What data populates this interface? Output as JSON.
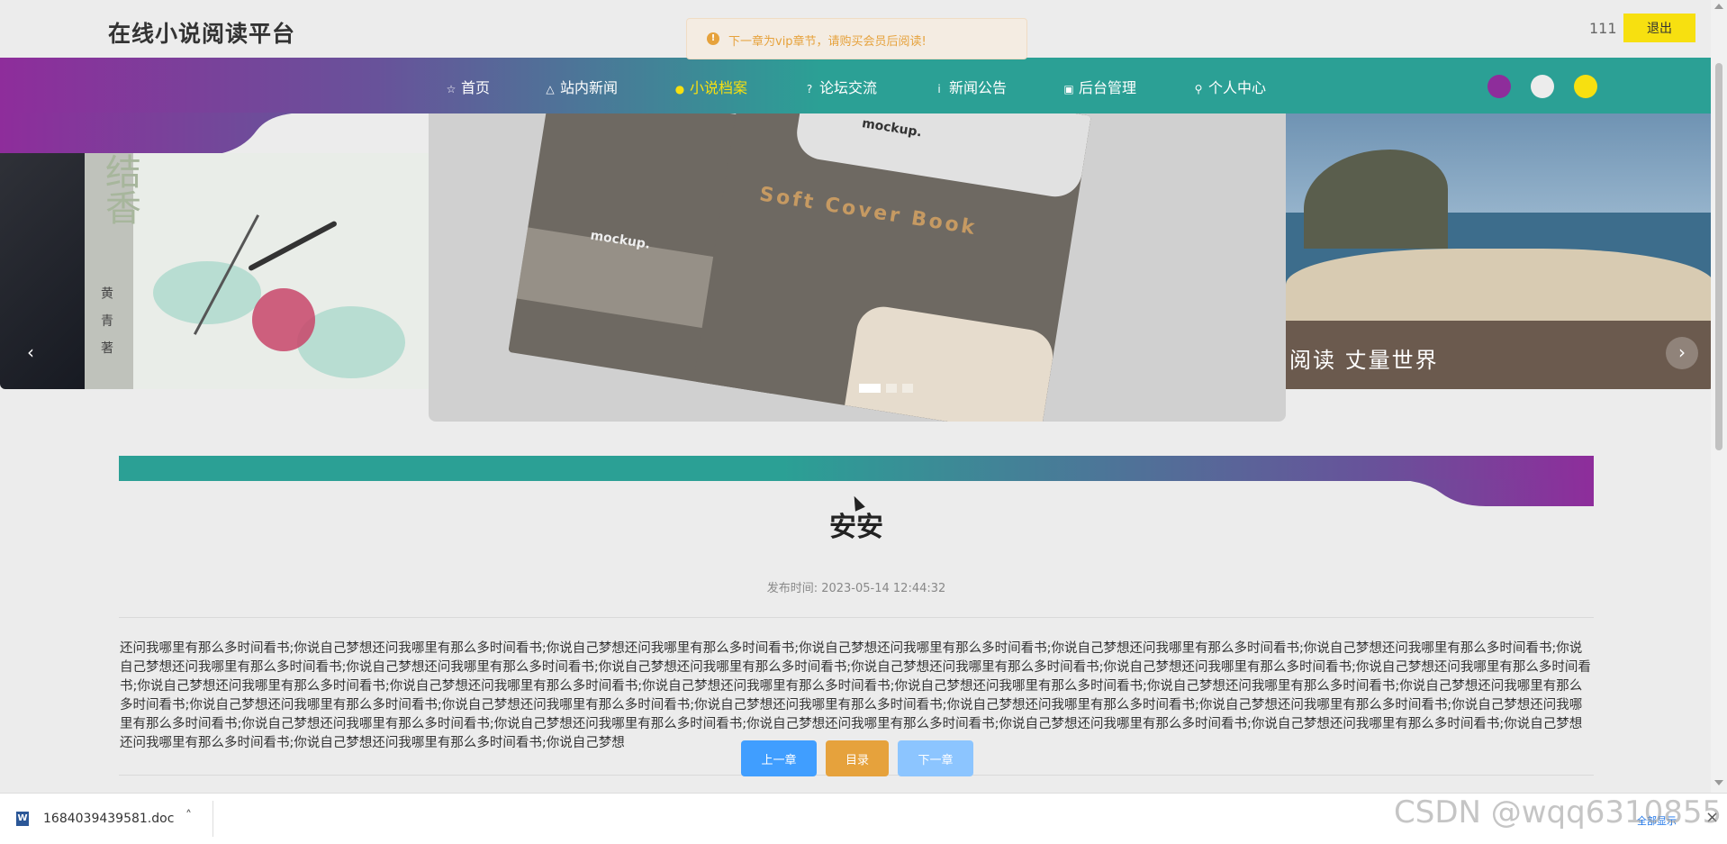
{
  "site": {
    "title": "在线小说阅读平台",
    "username": "111",
    "logout_label": "退出"
  },
  "nav": {
    "items": [
      {
        "label": "首页",
        "icon": "star-icon",
        "glyph": "☆",
        "active": false
      },
      {
        "label": "站内新闻",
        "icon": "bag-icon",
        "glyph": "△",
        "active": false
      },
      {
        "label": "小说档案",
        "icon": "info-circle-icon",
        "glyph": "●",
        "active": true
      },
      {
        "label": "论坛交流",
        "icon": "question-circle-icon",
        "glyph": "?",
        "active": false
      },
      {
        "label": "新闻公告",
        "icon": "info-icon",
        "glyph": "i",
        "active": false
      },
      {
        "label": "后台管理",
        "icon": "briefcase-icon",
        "glyph": "▣",
        "active": false
      },
      {
        "label": "个人中心",
        "icon": "user-icon",
        "glyph": "⚲",
        "active": false
      }
    ],
    "theme_colors": [
      "#8e2d9b",
      "#ececec",
      "#f7e010"
    ],
    "active_color": "#f7e010"
  },
  "toast": {
    "message": "下一章为vip章节，请购买会员后阅读!",
    "icon": "warning-icon"
  },
  "carousel": {
    "left": {
      "title": "结香",
      "author": "黄 青 著"
    },
    "center": {
      "logo": "mockup.",
      "cover_text": "Soft Cover Book",
      "back_logo": "mockup."
    },
    "right": {
      "caption": "阅读 丈量世界"
    },
    "slide_count": 3,
    "active_index": 0,
    "prev_icon": "chevron-left-icon",
    "next_icon": "chevron-right-icon"
  },
  "chapter": {
    "title": "安安",
    "publish_label": "发布时间:",
    "publish_time": "2023-05-14 12:44:32",
    "content": "还问我哪里有那么多时间看书;你说自己梦想还问我哪里有那么多时间看书;你说自己梦想还问我哪里有那么多时间看书;你说自己梦想还问我哪里有那么多时间看书;你说自己梦想还问我哪里有那么多时间看书;你说自己梦想还问我哪里有那么多时间看书;你说自己梦想还问我哪里有那么多时间看书;你说自己梦想还问我哪里有那么多时间看书;你说自己梦想还问我哪里有那么多时间看书;你说自己梦想还问我哪里有那么多时间看书;你说自己梦想还问我哪里有那么多时间看书;你说自己梦想还问我哪里有那么多时间看书;你说自己梦想还问我哪里有那么多时间看书;你说自己梦想还问我哪里有那么多时间看书;你说自己梦想还问我哪里有那么多时间看书;你说自己梦想还问我哪里有那么多时间看书;你说自己梦想还问我哪里有那么多时间看书;你说自己梦想还问我哪里有那么多时间看书;你说自己梦想还问我哪里有那么多时间看书;你说自己梦想还问我哪里有那么多时间看书;你说自己梦想还问我哪里有那么多时间看书;你说自己梦想还问我哪里有那么多时间看书;你说自己梦想还问我哪里有那么多时间看书;你说自己梦想还问我哪里有那么多时间看书;你说自己梦想还问我哪里有那么多时间看书;你说自己梦想还问我哪里有那么多时间看书;你说自己梦想还问我哪里有那么多时间看书;你说自己梦想还问我哪里有那么多时间看书;你说自己梦想还问我哪里有那么多时间看书;你说自己梦想还问我哪里有那么多时间看书;你说自己梦想还问我哪里有那么多时间看书;你说自己梦想"
  },
  "buttons": {
    "prev": "上一章",
    "toc": "目录",
    "next": "下一章"
  },
  "download_bar": {
    "filename": "1684039439581.doc",
    "file_icon": "word-doc-icon",
    "show_all": "全部显示"
  },
  "watermark": "CSDN @wqq6310855"
}
